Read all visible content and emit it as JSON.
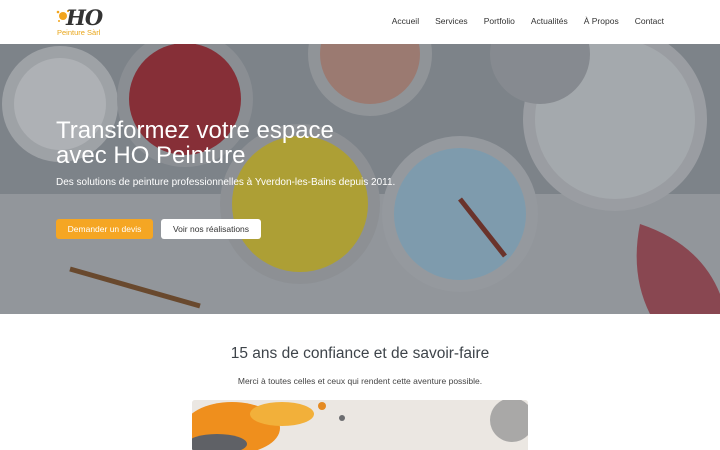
{
  "brand": {
    "logo_text": "HO",
    "logo_subtext": "Peinture Sàrl"
  },
  "nav": {
    "items": [
      "Accueil",
      "Services",
      "Portfolio",
      "Actualités",
      "À Propos",
      "Contact"
    ]
  },
  "hero": {
    "title_line1": "Transformez votre espace",
    "title_line2": "avec HO Peinture",
    "subtitle": "Des solutions de peinture professionnelles à Yverdon-les-Bains depuis 2011.",
    "primary_button": "Demander un devis",
    "secondary_button": "Voir nos réalisations"
  },
  "intro": {
    "title": "15 ans de confiance et de savoir-faire",
    "text": "Merci à toutes celles et ceux qui rendent cette aventure possible."
  },
  "colors": {
    "accent": "#f5a623",
    "text_dark": "#333333",
    "white": "#ffffff"
  }
}
